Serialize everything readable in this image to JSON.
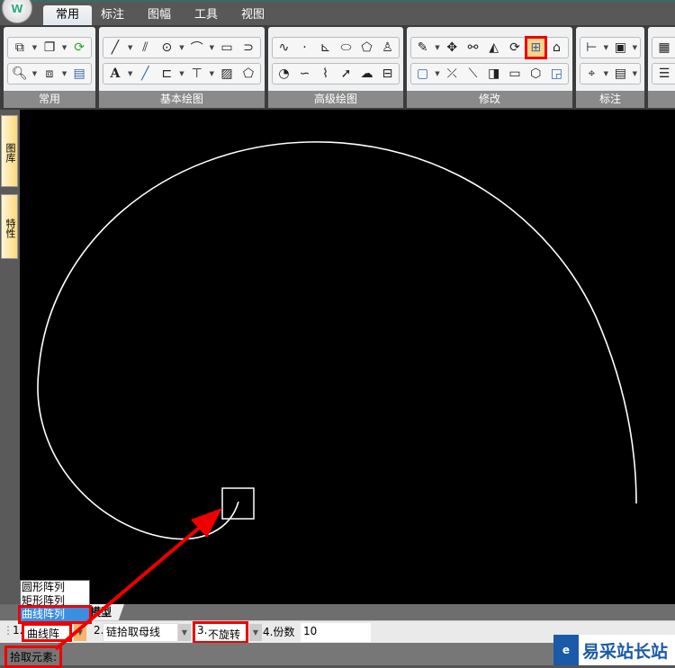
{
  "tabs": [
    "常用",
    "标注",
    "图幅",
    "工具",
    "视图"
  ],
  "active_tab": "常用",
  "panels": [
    "常用",
    "基本绘图",
    "高级绘图",
    "修改",
    "标注"
  ],
  "sidebar": [
    "图库",
    "特性"
  ],
  "model_tab": "模型",
  "dropdown_options": [
    "圆形阵列",
    "矩形阵列",
    "曲线阵列"
  ],
  "dropdown_selected": "曲线阵列",
  "cmd": {
    "l1": "1.",
    "v1": "曲线阵列",
    "l2": "2.",
    "v2": "链拾取母线",
    "l3": "3.",
    "v3": "不旋转",
    "l4": "4.份数",
    "v4": "10"
  },
  "status_prompt": "拾取元素:",
  "watermark": "易采站长站",
  "colors": {
    "highlight": "#ee0000",
    "selected": "#3b8fe0"
  }
}
